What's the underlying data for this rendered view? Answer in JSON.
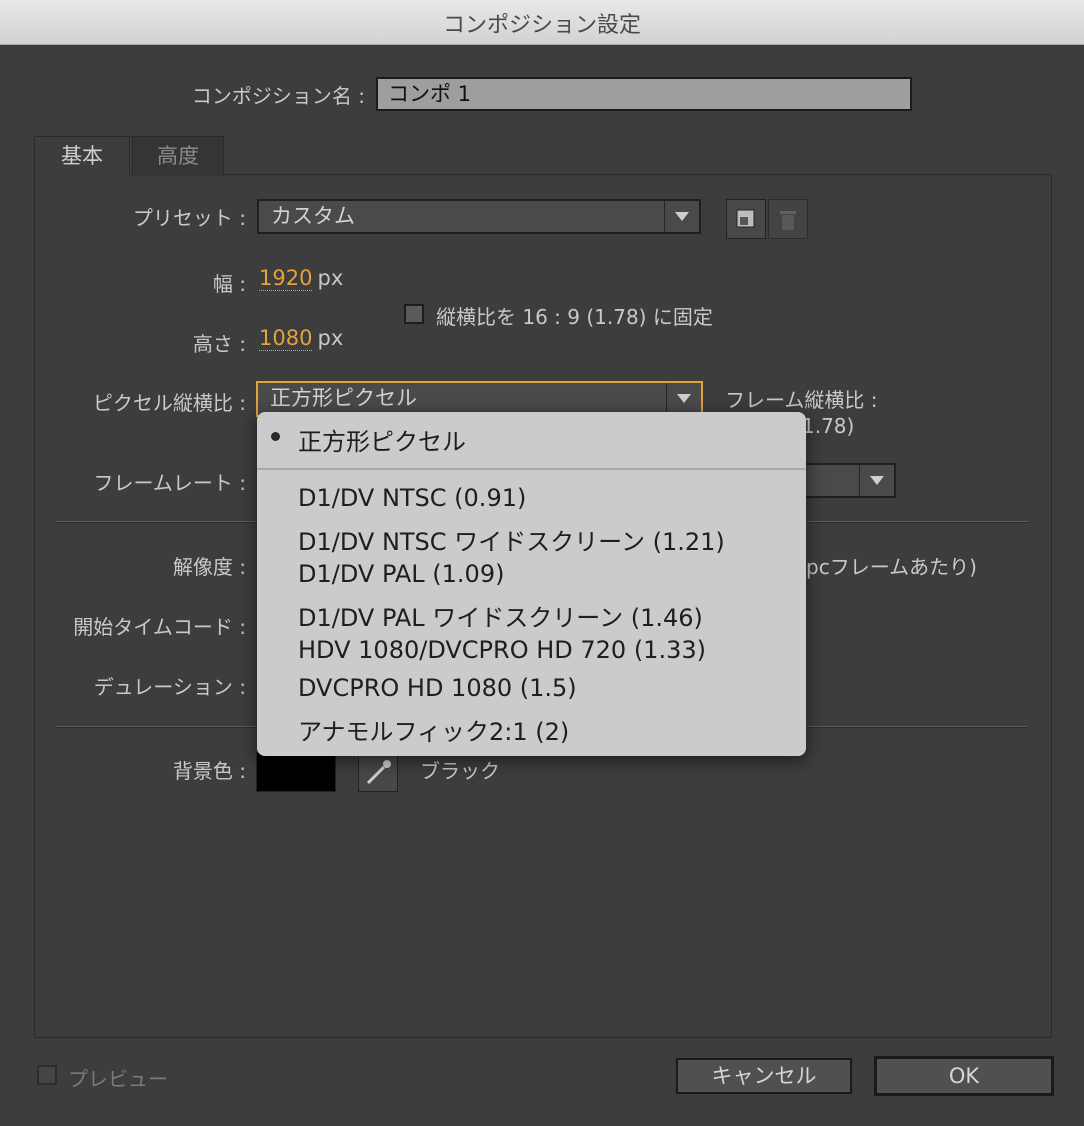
{
  "window": {
    "title": "コンポジション設定"
  },
  "comp_name": {
    "label": "コンポジション名 :",
    "value": "コンポ 1"
  },
  "tabs": [
    {
      "label": "基本"
    },
    {
      "label": "高度"
    }
  ],
  "preset": {
    "label": "プリセット :",
    "value": "カスタム"
  },
  "width": {
    "label": "幅 :",
    "value": "1920",
    "unit": "px"
  },
  "height": {
    "label": "高さ :",
    "value": "1080",
    "unit": "px"
  },
  "lock_aspect": {
    "label": "縦横比を 16 : 9 (1.78) に固定",
    "checked": false
  },
  "pixel_aspect": {
    "label": "ピクセル縦横比 :",
    "value": "正方形ピクセル",
    "options": [
      "正方形ピクセル",
      "D1/DV NTSC (0.91)",
      "D1/DV NTSC ワイドスクリーン (1.21)",
      "D1/DV PAL (1.09)",
      "D1/DV PAL ワイドスクリーン (1.46)",
      "HDV 1080/DVCPRO HD 720 (1.33)",
      "DVCPRO HD 1080 (1.5)",
      "アナモルフィック2:1 (2)"
    ]
  },
  "frame_aspect": {
    "label": "フレーム縦横比 :",
    "value": "1.78)"
  },
  "frame_rate": {
    "label": "フレームレート :"
  },
  "resolution": {
    "label": "解像度 :",
    "suffix": "pcフレームあたり)"
  },
  "start_timecode": {
    "label": "開始タイムコード :"
  },
  "duration": {
    "label": "デュレーション :"
  },
  "background": {
    "label": "背景色 :",
    "color_name": "ブラック",
    "color": "#000000"
  },
  "preview": {
    "label": "プレビュー"
  },
  "buttons": {
    "cancel": "キャンセル",
    "ok": "OK"
  },
  "colors": {
    "accent": "#e3a23a",
    "dialog_bg": "#3d3d3d",
    "menu_bg": "#cbcbcb"
  }
}
